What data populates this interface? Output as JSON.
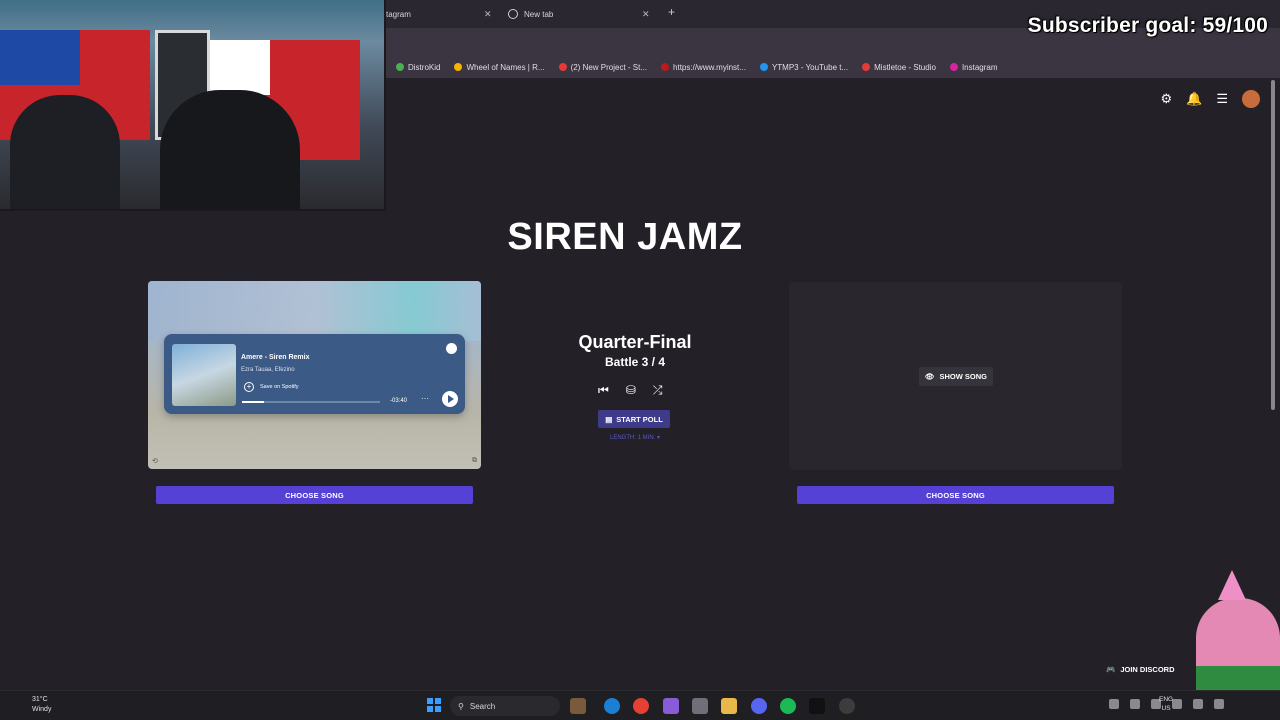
{
  "browser": {
    "tabs": [
      {
        "label": "tagram"
      },
      {
        "label": "New tab"
      }
    ],
    "bookmarks": [
      {
        "label": "DistroKid",
        "color": "#4caf50"
      },
      {
        "label": "Wheel of Names | R...",
        "color": "#f4b400"
      },
      {
        "label": "(2) New Project - St...",
        "color": "#e53935"
      },
      {
        "label": "https://www.myinst...",
        "color": "#b71c1c"
      },
      {
        "label": "YTMP3 - YouTube t...",
        "color": "#2196f3"
      },
      {
        "label": "Mistletoe - Studio",
        "color": "#e53935"
      },
      {
        "label": "Instagram",
        "color": "#d6249f"
      }
    ]
  },
  "overlay": {
    "subscriber_goal": "Subscriber goal: 59/100"
  },
  "app": {
    "title": "SIREN JAMZ",
    "round": "Quarter-Final",
    "battle": "Battle 3 / 4",
    "start_poll": "START POLL",
    "length": "LENGTH: 1 MIN. ▾",
    "choose_song_left": "CHOOSE SONG",
    "choose_song_right": "CHOOSE SONG",
    "show_song": "SHOW SONG",
    "join_discord": "JOIN DISCORD"
  },
  "spotify_embed": {
    "title": "Amere - Siren Remix",
    "artist": "Ezra Tauaa, Efezino",
    "save_label": "Save on Spotify",
    "time": "-03:40",
    "progress": 0.16
  },
  "taskbar": {
    "temp": "31°C",
    "condition": "Windy",
    "search_placeholder": "Search",
    "lang_1": "ENG",
    "lang_2": "US"
  },
  "colors": {
    "background": "#232127",
    "accent": "#5641d6"
  }
}
